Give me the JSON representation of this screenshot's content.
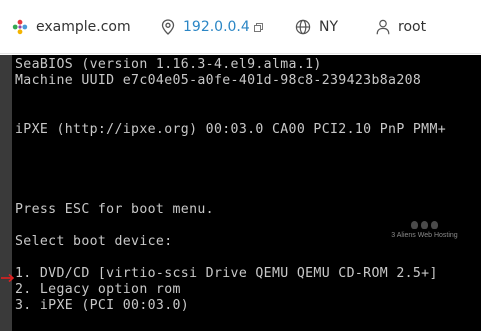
{
  "header": {
    "hostname": "example.com",
    "ip": "192.0.0.4",
    "location": "NY",
    "user": "root"
  },
  "icons": {
    "logo": "hosting-logo-icon",
    "copy": "copy-icon",
    "location": "globe-icon",
    "user": "user-icon"
  },
  "console": {
    "lines": [
      "SeaBIOS (version 1.16.3-4.el9.alma.1)",
      "Machine UUID e7c04e05-a0fe-401d-98c8-239423b8a208",
      "iPXE (http://ipxe.org) 00:03.0 CA00 PCI2.10 PnP PMM+",
      "Press ESC for boot menu.",
      "Select boot device:",
      "1. DVD/CD [virtio-scsi Drive QEMU QEMU CD-ROM 2.5+]",
      "2. Legacy option rom",
      "3. iPXE (PCI 00:03.0)"
    ],
    "selected_index": 0
  },
  "watermark": {
    "text": "3 Aliens Web Hosting"
  },
  "colors": {
    "console_bg": "#000000",
    "console_text": "#c8c8c8",
    "ip_link": "#2b86c5",
    "arrow": "#e02020"
  }
}
